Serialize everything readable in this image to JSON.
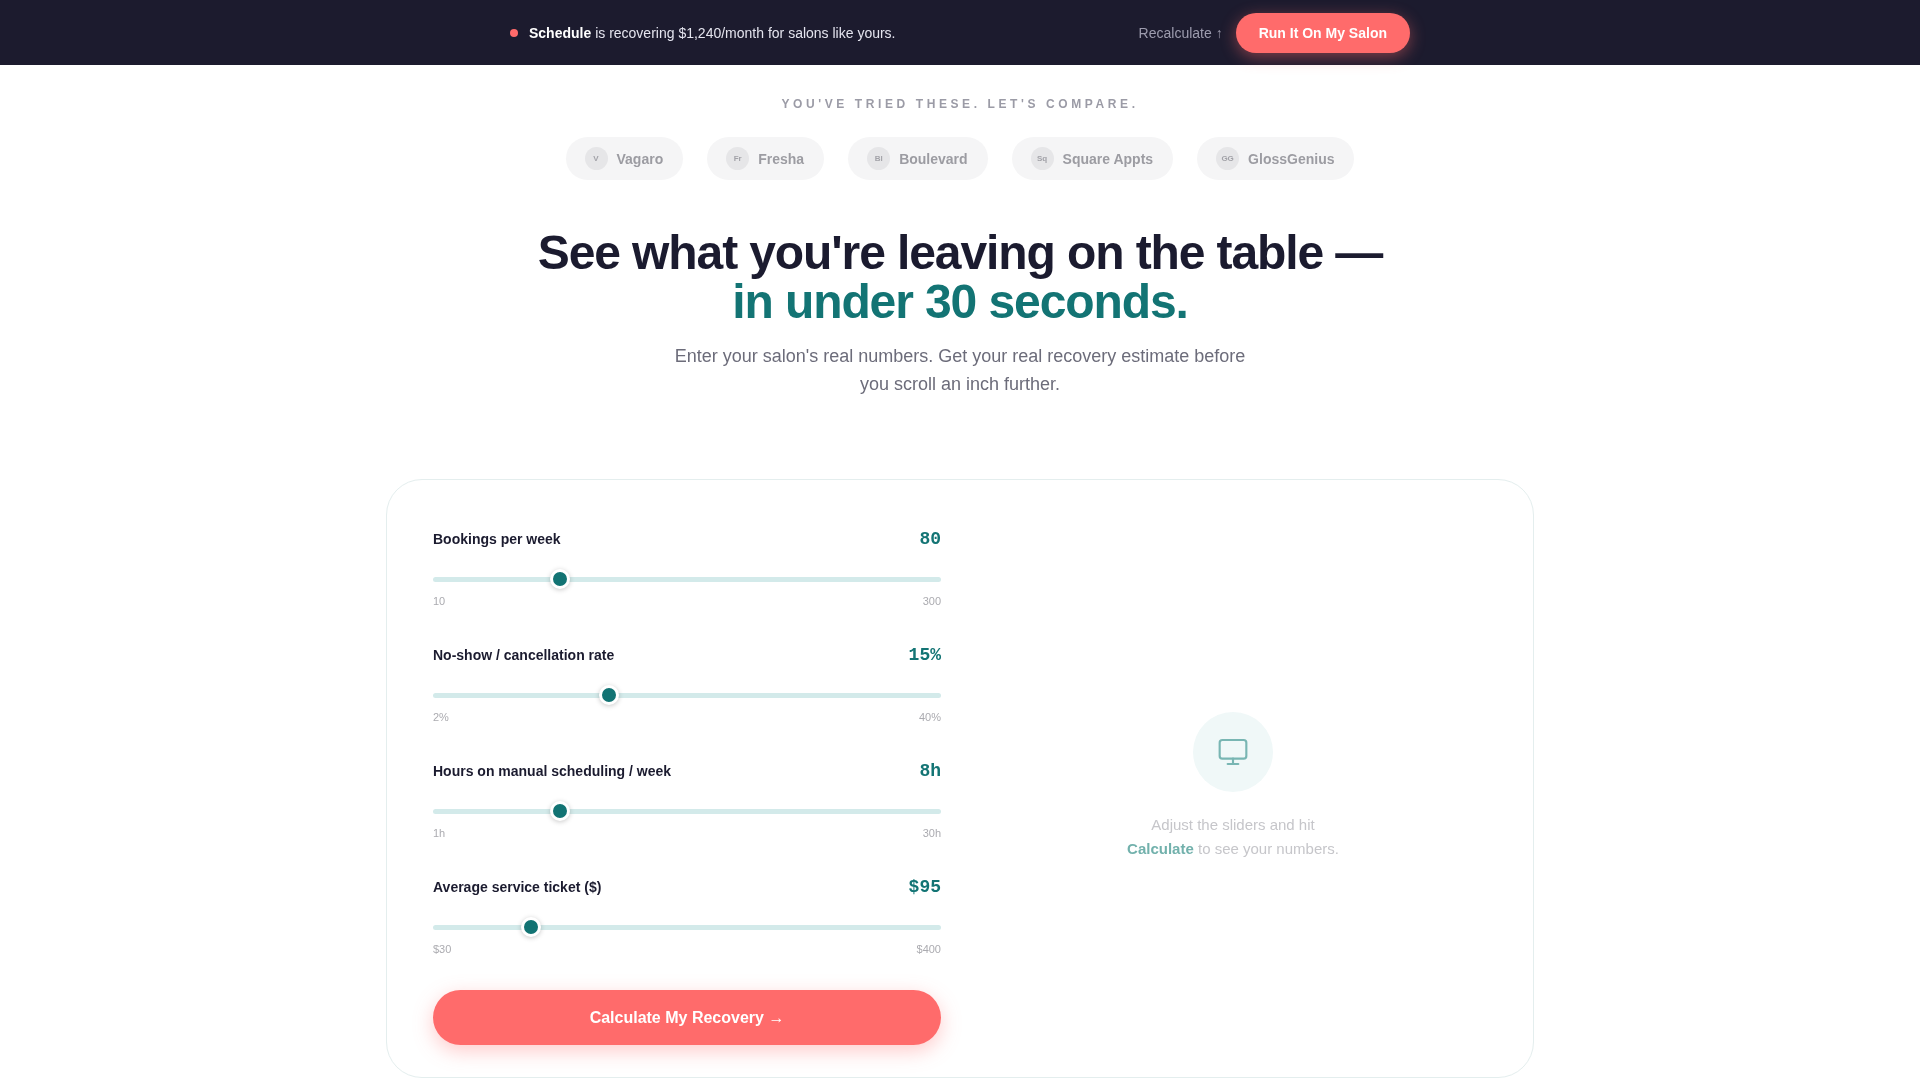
{
  "banner": {
    "message": "**Schedule** is recovering $1,240/month for salons like yours.",
    "link": "Recalculate ↑",
    "button": "Run It On My Salon"
  },
  "compare": {
    "eyebrow": "YOU'VE TRIED THESE. LET'S COMPARE.",
    "competitors": [
      {
        "initials": "V",
        "name": "Vagaro"
      },
      {
        "initials": "Fr",
        "name": "Fresha"
      },
      {
        "initials": "Bl",
        "name": "Boulevard"
      },
      {
        "initials": "Sq",
        "name": "Square Appts"
      },
      {
        "initials": "GG",
        "name": "GlossGenius"
      }
    ]
  },
  "hero": {
    "title": "See what you're leaving on the table —",
    "title_highlight": "in under 30 seconds.",
    "subtitle": "Enter your salon's real numbers. Get your real recovery estimate before you scroll an inch further."
  },
  "calculator": {
    "sliders": [
      {
        "label": "Bookings per week",
        "value": "80",
        "level": 0.24,
        "min": "10",
        "max": "300"
      },
      {
        "label": "No-show / cancellation rate",
        "value": "15%",
        "level": 0.34,
        "min": "2%",
        "max": "40%"
      },
      {
        "label": "Hours on manual scheduling / week",
        "value": "8h",
        "level": 0.24,
        "min": "1h",
        "max": "30h"
      },
      {
        "label": "Average service ticket ($)",
        "value": "$95",
        "level": 0.18,
        "min": "$30",
        "max": "$400"
      }
    ],
    "button": "Calculate My Recovery →",
    "empty_state": {
      "message": "Adjust the sliders and hit **Calculate** to see your numbers."
    }
  }
}
